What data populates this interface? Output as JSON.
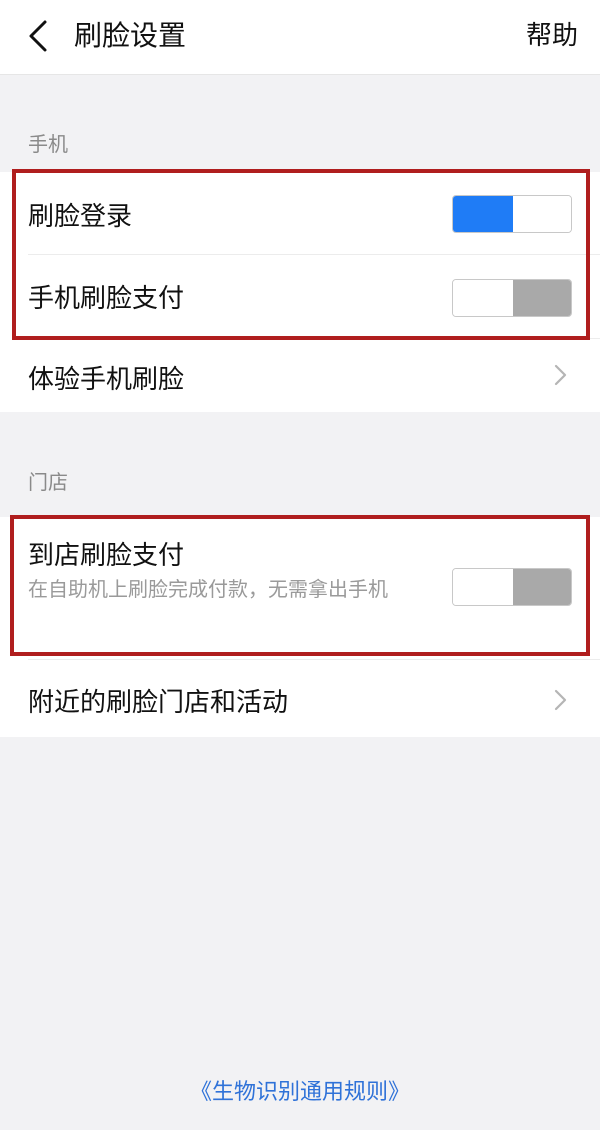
{
  "header": {
    "title": "刷脸设置",
    "help_label": "帮助",
    "back_icon": "chevron-left-icon"
  },
  "sections": {
    "phone": {
      "label": "手机",
      "items": {
        "face_login": {
          "label": "刷脸登录",
          "enabled": true
        },
        "face_pay_phone": {
          "label": "手机刷脸支付",
          "enabled": false
        },
        "try_face": {
          "label": "体验手机刷脸"
        }
      }
    },
    "store": {
      "label": "门店",
      "items": {
        "face_pay_store": {
          "label": "到店刷脸支付",
          "description": "在自助机上刷脸完成付款，无需拿出手机",
          "enabled": false
        },
        "nearby": {
          "label": "附近的刷脸门店和活动"
        }
      }
    }
  },
  "footer": {
    "rules_link": "《生物识别通用规则》"
  },
  "colors": {
    "toggle_on": "#1f7cf6",
    "toggle_off": "#a9a9a9",
    "highlight": "#b01e1e",
    "link": "#2f72d8"
  }
}
